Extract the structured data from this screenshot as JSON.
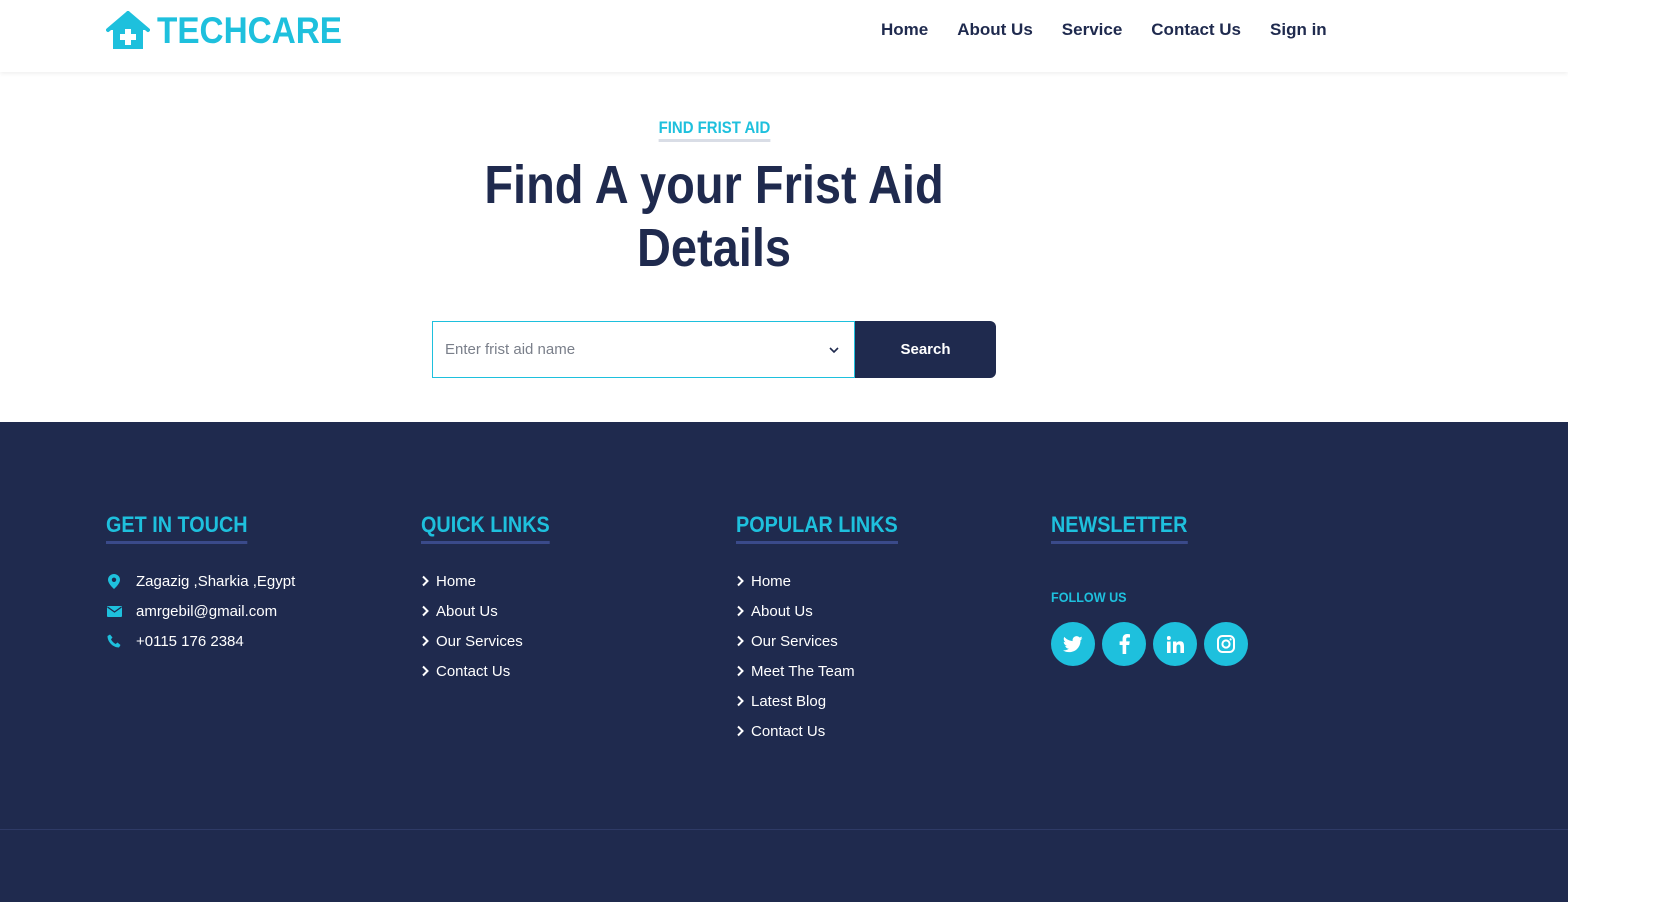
{
  "brand": {
    "name": "TECHCARE",
    "icon": "house-medical-icon"
  },
  "nav": {
    "items": [
      {
        "label": "Home"
      },
      {
        "label": "About Us"
      },
      {
        "label": "Service"
      },
      {
        "label": "Contact Us"
      },
      {
        "label": "Sign in"
      }
    ]
  },
  "hero": {
    "eyebrow": "FIND FRIST AID",
    "title_line1": "Find A your Frist Aid",
    "title_line2": "Details"
  },
  "search": {
    "placeholder": "Enter frist aid name",
    "button_label": "Search"
  },
  "footer": {
    "get_in_touch": {
      "heading": "GET IN TOUCH",
      "address": "Zagazig ,Sharkia ,Egypt",
      "email": "amrgebil@gmail.com",
      "phone": "+0115 176 2384"
    },
    "quick_links": {
      "heading": "QUICK LINKS",
      "items": [
        "Home",
        "About Us",
        "Our Services",
        "Contact Us"
      ]
    },
    "popular_links": {
      "heading": "POPULAR LINKS",
      "items": [
        "Home",
        "About Us",
        "Our Services",
        "Meet The Team",
        "Latest Blog",
        "Contact Us"
      ]
    },
    "newsletter": {
      "heading": "NEWSLETTER",
      "follow_label": "FOLLOW US",
      "socials": [
        "twitter-icon",
        "facebook-icon",
        "linkedin-icon",
        "instagram-icon"
      ]
    }
  },
  "colors": {
    "accent": "#1ec0dd",
    "navy": "#1f2a4e",
    "underline": "#3a4a8a"
  }
}
